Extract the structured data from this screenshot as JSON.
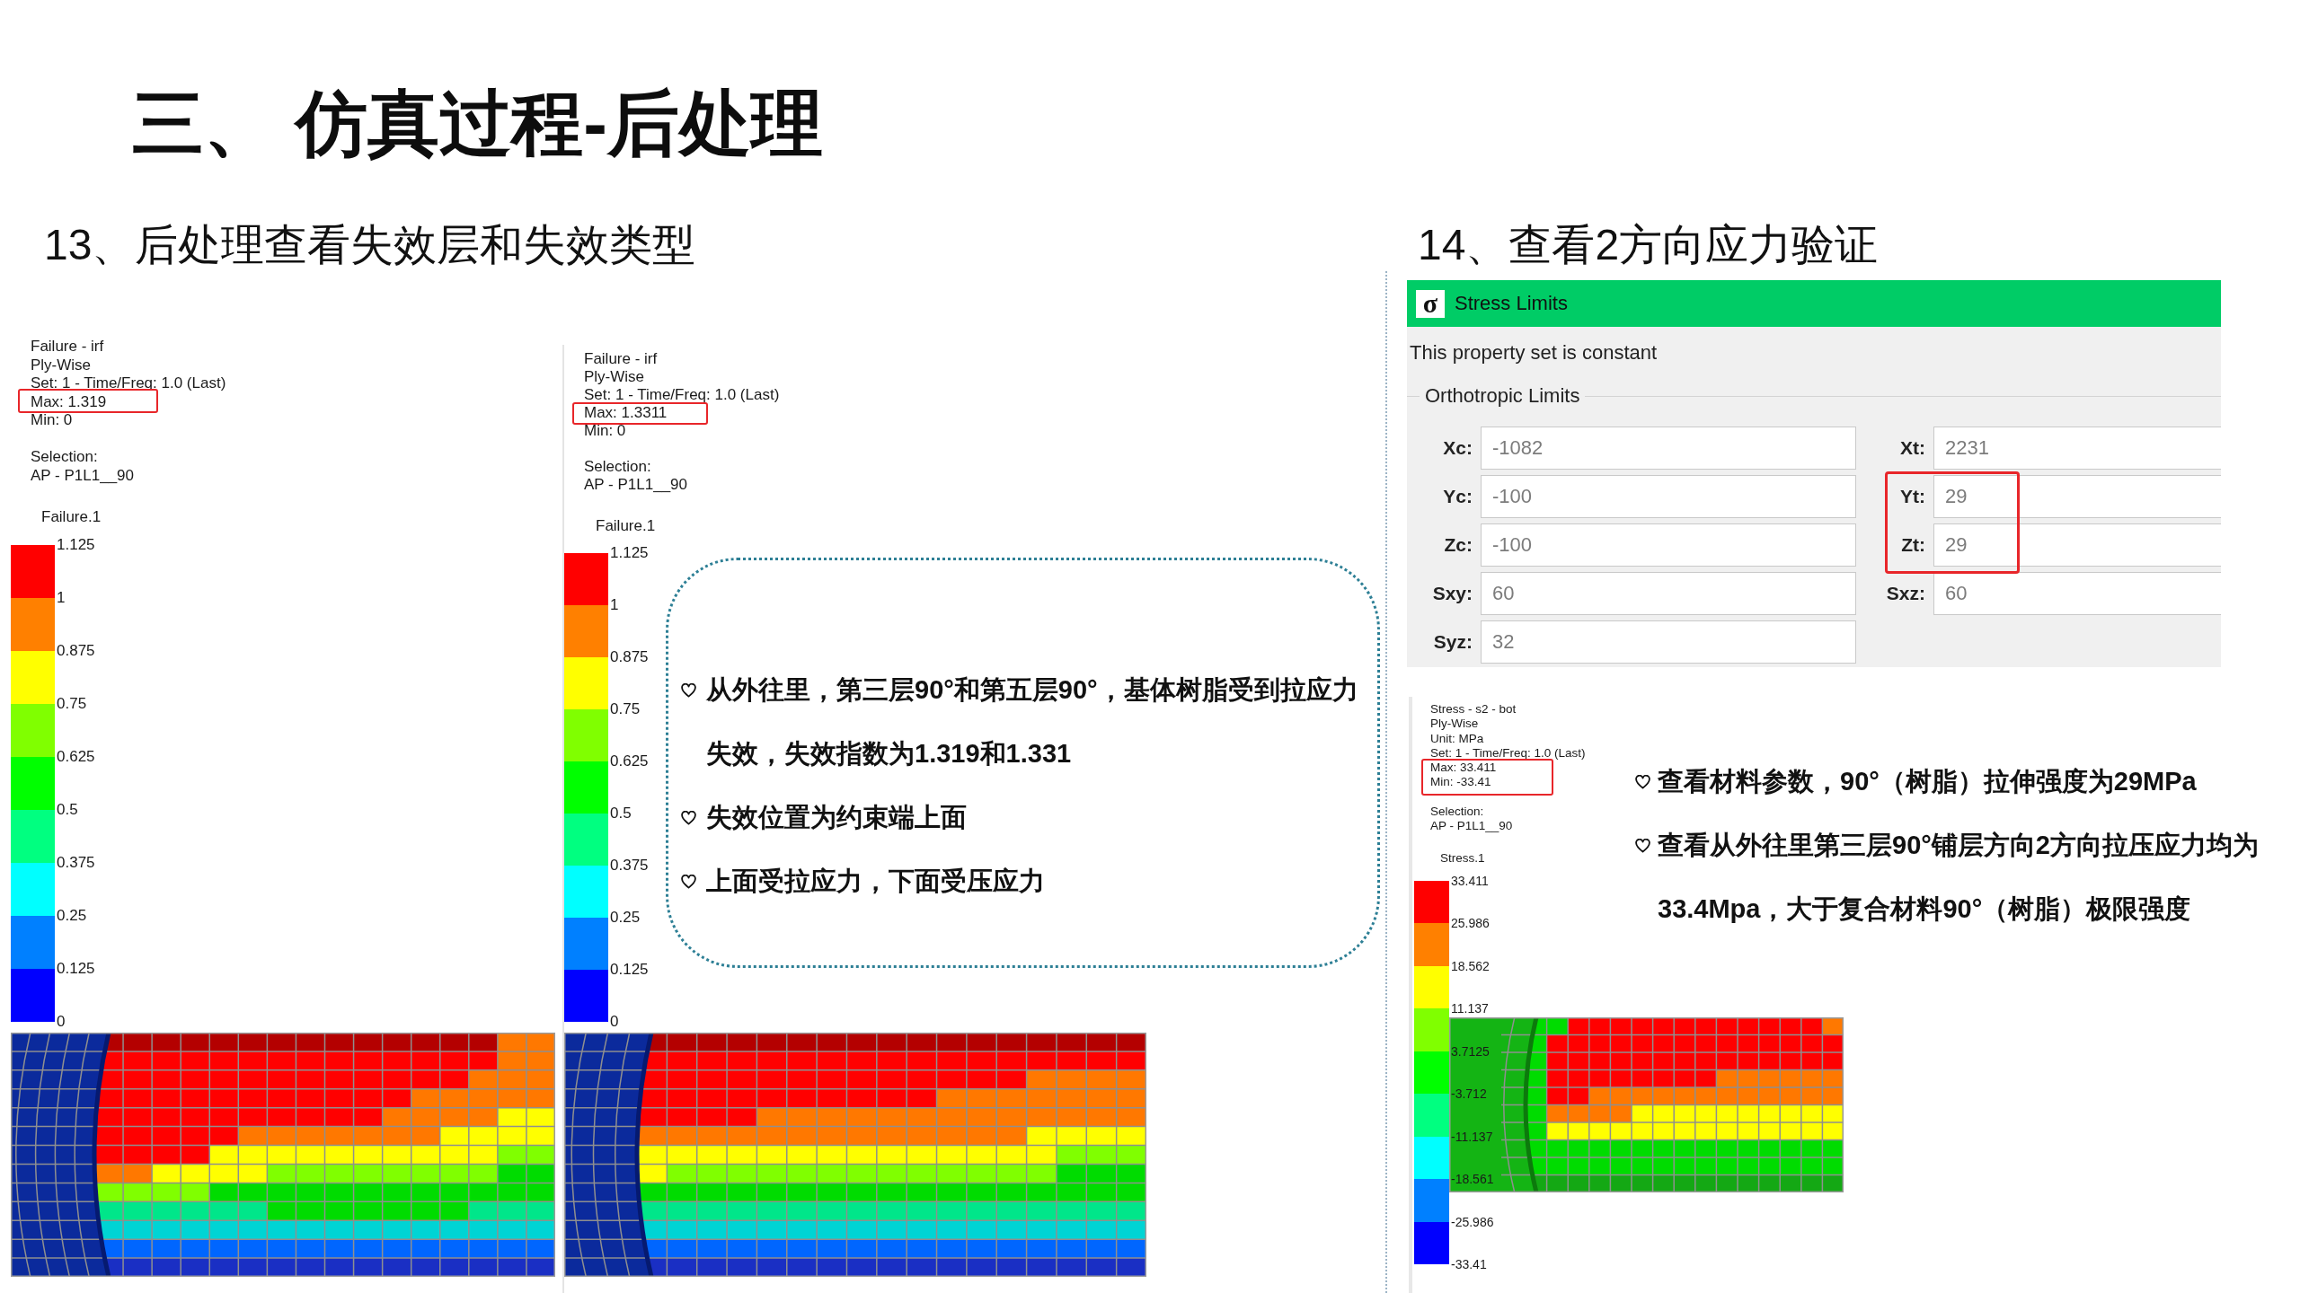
{
  "title": "三、 仿真过程-后处理",
  "left_section": {
    "heading": "13、后处理查看失效层和失效类型",
    "views": [
      {
        "info": [
          {
            "text": "Failure - irf",
            "highlighted": false
          },
          {
            "text": "Ply-Wise",
            "highlighted": false
          },
          {
            "text": "Set: 1 - Time/Freq: 1.0 (Last)",
            "highlighted": false
          },
          {
            "text": "Max: 1.319",
            "highlighted": true
          },
          {
            "text": "Min: 0",
            "highlighted": false
          }
        ],
        "selection": [
          "Selection:",
          "AP - P1L1__90"
        ],
        "legend": {
          "title": "Failure.1",
          "ticks": [
            "1.125",
            "1",
            "0.875",
            "0.75",
            "0.625",
            "0.5",
            "0.375",
            "0.25",
            "0.125",
            "0"
          ],
          "bands": [
            {
              "color": "#ff0000"
            },
            {
              "color": "#ff8000"
            },
            {
              "color": "#ffff00"
            },
            {
              "color": "#80ff00"
            },
            {
              "color": "#00ff00"
            },
            {
              "color": "#00ff80"
            },
            {
              "color": "#00ffff"
            },
            {
              "color": "#0080ff"
            },
            {
              "color": "#0000ff"
            }
          ]
        }
      },
      {
        "info": [
          {
            "text": "Failure - irf",
            "highlighted": false
          },
          {
            "text": "Ply-Wise",
            "highlighted": false
          },
          {
            "text": "Set: 1 - Time/Freq: 1.0 (Last)",
            "highlighted": false
          },
          {
            "text": "Max: 1.3311",
            "highlighted": true
          },
          {
            "text": "Min: 0",
            "highlighted": false
          }
        ],
        "selection": [
          "Selection:",
          "AP - P1L1__90"
        ],
        "legend": {
          "title": "Failure.1",
          "ticks": [
            "1.125",
            "1",
            "0.875",
            "0.75",
            "0.625",
            "0.5",
            "0.375",
            "0.25",
            "0.125",
            "0"
          ],
          "bands": [
            {
              "color": "#ff0000"
            },
            {
              "color": "#ff8000"
            },
            {
              "color": "#ffff00"
            },
            {
              "color": "#80ff00"
            },
            {
              "color": "#00ff00"
            },
            {
              "color": "#00ff80"
            },
            {
              "color": "#00ffff"
            },
            {
              "color": "#0080ff"
            },
            {
              "color": "#0000ff"
            }
          ]
        }
      }
    ],
    "callout": {
      "bullets": [
        "从外往里，第三层90°和第五层90°，基体树脂受到拉应力失效，失效指数为1.319和1.331",
        "失效位置为约束端上面",
        "上面受拉应力，下面受压应力"
      ]
    }
  },
  "right_section": {
    "heading": "14、查看2方向应力验证",
    "dialog": {
      "icon": "σ",
      "title": "Stress Limits",
      "note": "This property set is constant",
      "group": "Orthotropic Limits",
      "rows": [
        {
          "left": {
            "label": "Xc:",
            "value": "-1082"
          },
          "right": {
            "label": "Xt:",
            "value": "2231",
            "highlighted": false
          }
        },
        {
          "left": {
            "label": "Yc:",
            "value": "-100"
          },
          "right": {
            "label": "Yt:",
            "value": "29",
            "highlighted": true
          }
        },
        {
          "left": {
            "label": "Zc:",
            "value": "-100"
          },
          "right": {
            "label": "Zt:",
            "value": "29",
            "highlighted": true
          }
        },
        {
          "left": {
            "label": "Sxy:",
            "value": "60"
          },
          "right": {
            "label": "Sxz:",
            "value": "60",
            "highlighted": false
          }
        },
        {
          "left": {
            "label": "Syz:",
            "value": "32"
          }
        }
      ]
    },
    "view": {
      "info": [
        {
          "text": "Stress - s2 - bot",
          "highlighted": false
        },
        {
          "text": "Ply-Wise",
          "highlighted": false
        },
        {
          "text": "Unit: MPa",
          "highlighted": false
        },
        {
          "text": "Set: 1 - Time/Freq: 1.0 (Last)",
          "highlighted": false
        },
        {
          "text": "Max: 33.411",
          "highlighted": true
        },
        {
          "text": "Min: -33.41",
          "highlighted": true
        }
      ],
      "selection": [
        "Selection:",
        "AP - P1L1__90"
      ],
      "legend": {
        "title": "Stress.1",
        "ticks": [
          "33.411",
          "25.986",
          "18.562",
          "11.137",
          "3.7125",
          "-3.712",
          "-11.137",
          "-18.561",
          "-25.986",
          "-33.41"
        ],
        "bands": [
          {
            "color": "#ff0000"
          },
          {
            "color": "#ff8000"
          },
          {
            "color": "#ffff00"
          },
          {
            "color": "#80ff00"
          },
          {
            "color": "#00ff00"
          },
          {
            "color": "#00ff80"
          },
          {
            "color": "#00ffff"
          },
          {
            "color": "#0080ff"
          },
          {
            "color": "#0000ff"
          }
        ]
      }
    },
    "bullets": [
      "查看材料参数，90°（树脂）拉伸强度为29MPa",
      "查看从外往里第三层90°铺层方向2方向拉压应力均为33.4Mpa，大于复合材料90°（树脂）极限强度"
    ]
  }
}
